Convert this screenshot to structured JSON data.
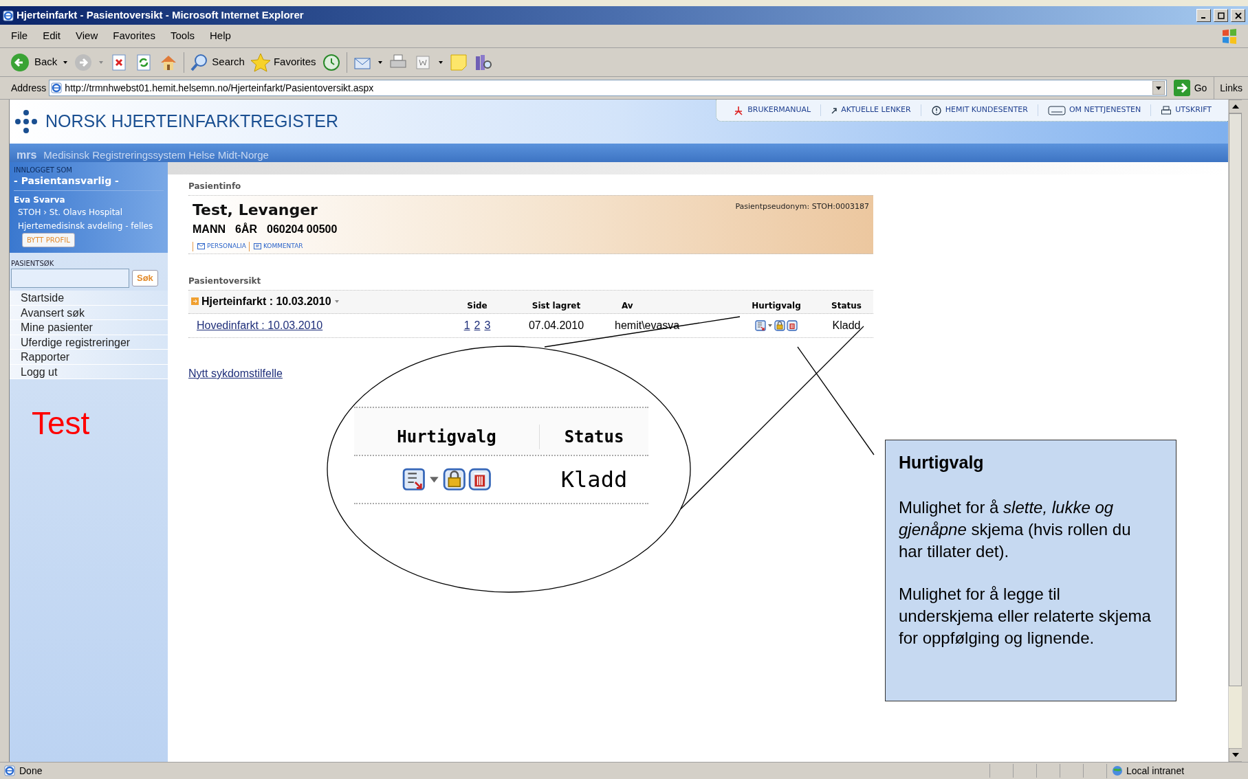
{
  "window": {
    "title": "Hjerteinfarkt - Pasientoversikt - Microsoft Internet Explorer"
  },
  "menu": [
    "File",
    "Edit",
    "View",
    "Favorites",
    "Tools",
    "Help"
  ],
  "toolbar": {
    "back": "Back",
    "search": "Search",
    "favorites": "Favorites"
  },
  "address_bar": {
    "label": "Address",
    "url": "http://trmnhwebst01.hemit.helsemn.no/Hjerteinfarkt/Pasientoversikt.aspx",
    "go": "Go",
    "links": "Links"
  },
  "site_header": {
    "logo": "NORSK HJERTEINFARKTREGISTER",
    "band_logo": "mrs",
    "subtitle": "Medisinsk Registreringssystem Helse Midt-Norge",
    "links": [
      "BRUKERMANUAL",
      "AKTUELLE LENKER",
      "HEMIT KUNDESENTER",
      "OM NETTJENESTEN",
      "UTSKRIFT"
    ]
  },
  "sidebar": {
    "logged_in_label": "INNLOGGET SOM",
    "role": "- Pasientansvarlig -",
    "user": "Eva Svarva",
    "org": "STOH › St. Olavs Hospital",
    "department": "Hjertemedisinsk avdeling - felles",
    "switch_profile": "BYTT PROFIL",
    "search_label": "PASIENTSØK",
    "search_button": "Søk",
    "nav": [
      "Startside",
      "Avansert søk",
      "Mine pasienter",
      "Uferdige registreringer",
      "Rapporter",
      "Logg ut"
    ],
    "note": "Test"
  },
  "patient_info": {
    "heading": "Pasientinfo",
    "name": "Test, Levanger",
    "sex": "MANN",
    "age": "6ÅR",
    "id": "060204 00500",
    "pseudonym": "Pasientpseudonym: STOH:0003187",
    "tabs": [
      "PERSONALIA",
      "KOMMENTAR"
    ]
  },
  "overview": {
    "heading": "Pasientoversikt",
    "group": "Hjerteinfarkt : 10.03.2010",
    "columns": [
      "Side",
      "Sist lagret",
      "Av",
      "Hurtigvalg",
      "Status"
    ],
    "rows": [
      {
        "form": "Hovedinfarkt : 10.03.2010",
        "pages": [
          "1",
          "2",
          "3"
        ],
        "saved": "07.04.2010",
        "by": "hemit\\evasva",
        "status": "Kladd"
      }
    ],
    "new_case": "Nytt sykdomstilfelle"
  },
  "magnifier": {
    "columns": [
      "Hurtigvalg",
      "Status"
    ],
    "status": "Kladd"
  },
  "callout": {
    "title": "Hurtigvalg",
    "paragraphs": [
      "Mulighet for å *slette, lukke og gjenåpne* skjema (hvis rollen du har tillater det).",
      "Mulighet for å legge til underskjema eller relaterte skjema for oppfølging og lignende."
    ]
  },
  "status_bar": {
    "text": "Done",
    "zone": "Local intranet"
  }
}
